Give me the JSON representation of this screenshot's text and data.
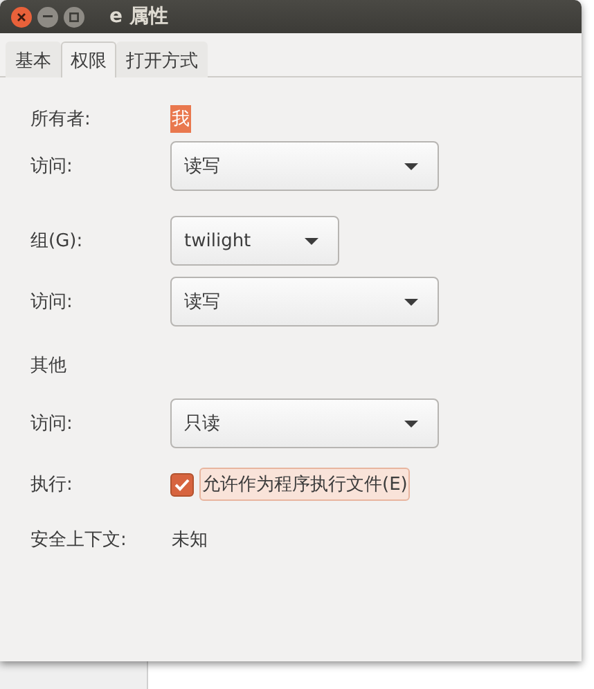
{
  "window": {
    "title": "e 属性"
  },
  "tabs": [
    {
      "label": "基本",
      "selected": false
    },
    {
      "label": "权限",
      "selected": true
    },
    {
      "label": "打开方式",
      "selected": false
    }
  ],
  "rows": [
    {
      "kind": "value",
      "label": "所有者:",
      "value": "我",
      "highlighted": true
    },
    {
      "kind": "dropdown",
      "label": "访问:",
      "value": "读写",
      "wide": true
    },
    {
      "kind": "dropdown",
      "label": "组(G):",
      "value": "twilight",
      "wide": false
    },
    {
      "kind": "dropdown",
      "label": "访问:",
      "value": "读写",
      "wide": true
    },
    {
      "kind": "heading",
      "label": "其他"
    },
    {
      "kind": "dropdown",
      "label": "访问:",
      "value": "只读",
      "wide": true
    },
    {
      "kind": "checkbox",
      "label": "执行:",
      "value": "允许作为程序执行文件(E)",
      "checked": true,
      "focused": true
    },
    {
      "kind": "value",
      "label": "安全上下文:",
      "value": "未知",
      "highlighted": false
    }
  ]
}
